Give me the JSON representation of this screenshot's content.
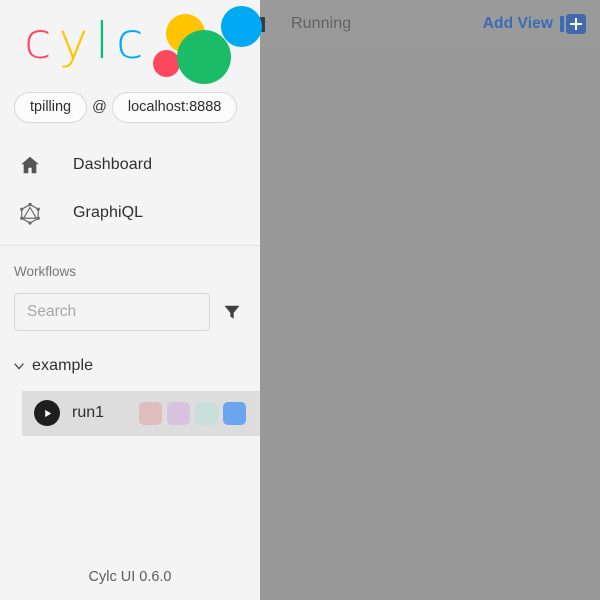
{
  "brand": {
    "letters": [
      {
        "char": "c",
        "color": "#ff4a5e"
      },
      {
        "char": "y",
        "color": "#ffc600"
      },
      {
        "char": "l",
        "color": "#00c176"
      },
      {
        "char": "c",
        "color": "#00aaff"
      }
    ],
    "dots": [
      {
        "name": "red-dot",
        "color": "#fb485e"
      },
      {
        "name": "yellow-dot",
        "color": "#ffc400"
      },
      {
        "name": "green-dot",
        "color": "#1abc68"
      },
      {
        "name": "blue-dot",
        "color": "#00a9f4"
      }
    ]
  },
  "user": {
    "name": "tpilling",
    "separator": "@",
    "host": "localhost:8888"
  },
  "nav": {
    "items": [
      {
        "label": "Dashboard",
        "icon": "home-icon"
      },
      {
        "label": "GraphiQL",
        "icon": "graphql-icon"
      }
    ]
  },
  "workflows": {
    "section_label": "Workflows",
    "search": {
      "value": "",
      "placeholder": "Search"
    },
    "filter_icon": "filter-funnel-icon",
    "tree": [
      {
        "label": "example",
        "expanded": true,
        "chevron_icon": "chevron-down-icon",
        "children": [
          {
            "label": "run1",
            "state_icon": "play-icon",
            "selected": true,
            "swatches": [
              {
                "name": "task-state-failed",
                "color": "#e0bdbd"
              },
              {
                "name": "task-state-submitted",
                "color": "#d9c4de"
              },
              {
                "name": "task-state-succeeded",
                "color": "#c8dfd9"
              },
              {
                "name": "task-state-running",
                "color": "#6ba4ef"
              }
            ]
          }
        ]
      }
    ]
  },
  "footer": {
    "version_text": "Cylc UI 0.6.0"
  },
  "topbar": {
    "status_icon": "stop-square-icon",
    "status_text": "Running",
    "add_view_label": "Add View",
    "add_view_icon": "add-plus-icon"
  },
  "colors": {
    "accent_link": "#3a6bb5",
    "accent_plus": "#4169ad",
    "sidebar_bg": "#f4f4f4",
    "main_overlay": "#999999",
    "selected_row": "#dddddd"
  }
}
